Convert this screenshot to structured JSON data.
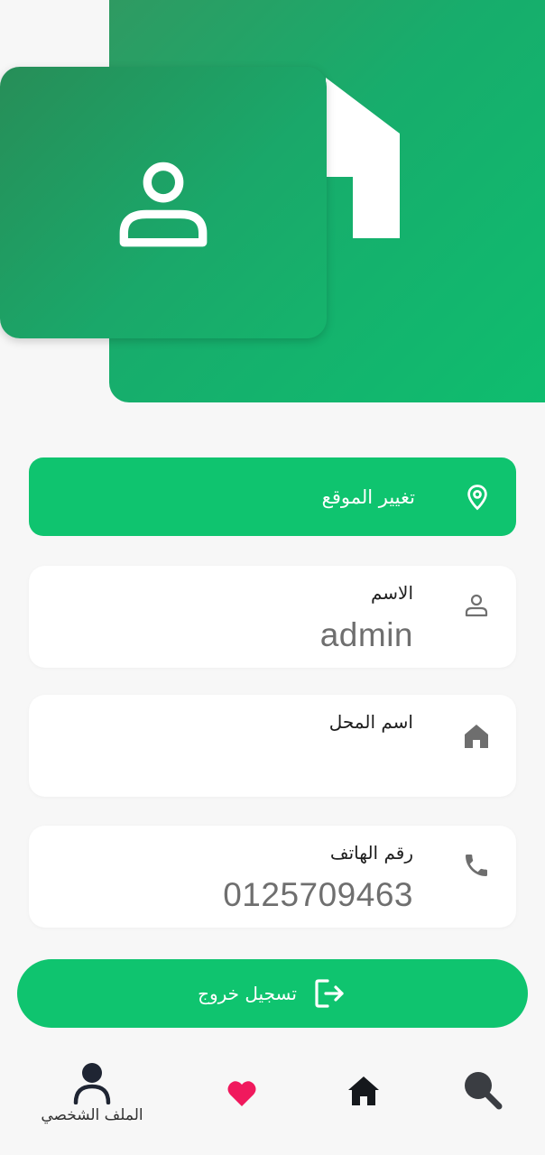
{
  "header": {
    "avatar_icon": "person-outline-icon",
    "decoration_icon": "house-icon"
  },
  "location_button": {
    "label": "تغيير الموقع",
    "icon": "location-pin-icon"
  },
  "profile_fields": [
    {
      "label": "الاسم",
      "value": "admin",
      "icon": "person-outline-icon"
    },
    {
      "label": "اسم المحل",
      "value": "",
      "icon": "store-home-icon"
    },
    {
      "label": "رقم الهاتف",
      "value": "0125709463",
      "icon": "phone-icon"
    }
  ],
  "logout_button": {
    "label": "تسجيل خروج",
    "icon": "logout-icon"
  },
  "bottom_nav": {
    "profile_label": "الملف الشخصي",
    "items": [
      "profile-icon",
      "heart-icon",
      "home-icon",
      "search-icon"
    ]
  },
  "colors": {
    "primary": "#0fc46f",
    "header_green": "#17ad6c",
    "favorite": "#f0195d",
    "nav_dark": "#1f2533"
  }
}
